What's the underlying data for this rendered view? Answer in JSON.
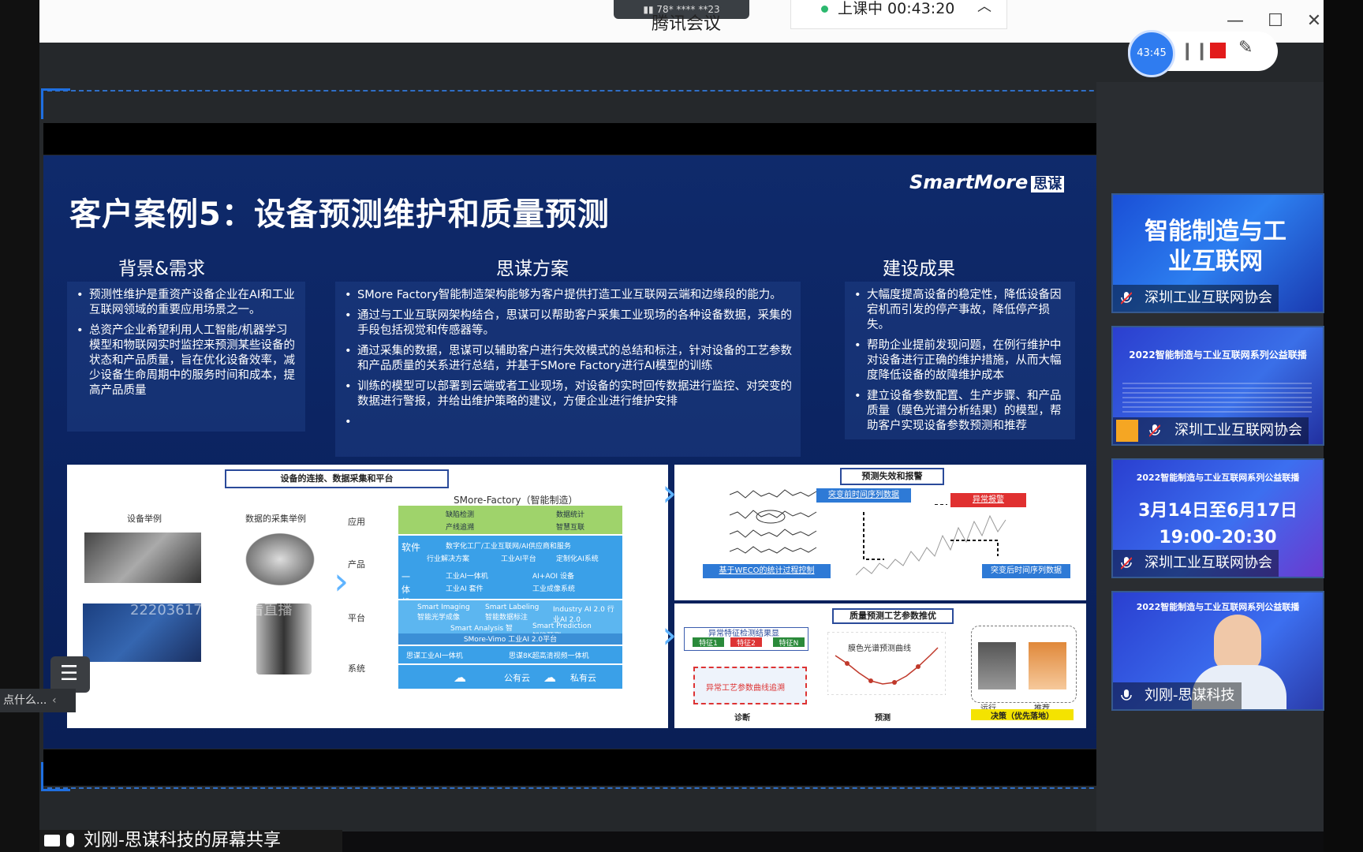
{
  "app": {
    "title": "腾讯会议",
    "signal_text": "78* **** **23",
    "timer_label": "上课中 00:43:20",
    "recording_time": "43:45"
  },
  "slide": {
    "title": "客户案例5：设备预测维护和质量预测",
    "logo": "SmartMore",
    "logo_cn": "思谋",
    "col1": {
      "heading": "背景&需求",
      "bullets": [
        "预测性维护是重资产设备企业在AI和工业互联网领域的重要应用场景之一。",
        "总资产企业希望利用人工智能/机器学习模型和物联网实时监控来预测某些设备的状态和产品质量，旨在优化设备效率，减少设备生命周期中的服务时间和成本，提高产品质量"
      ]
    },
    "col2": {
      "heading": "思谋方案",
      "bullets": [
        "SMore Factory智能制造架构能够为客户提供打造工业互联网云端和边缘段的能力。",
        "通过与工业互联网架构结合，思谋可以帮助客户采集工业现场的各种设备数据，采集的手段包括视觉和传感器等。",
        "通过采集的数据，思谋可以辅助客户进行失效模式的总结和标注，针对设备的工艺参数和产品质量的关系进行总结，并基于SMore Factory进行AI模型的训练",
        "训练的模型可以部署到云端或者工业现场，对设备的实时回传数据进行监控、对突变的数据进行警报，并给出维护策略的建议，方便企业进行维护安排",
        ""
      ]
    },
    "col3": {
      "heading": "建设成果",
      "bullets": [
        "大幅度提高设备的稳定性，降低设备因宕机而引发的停产事故，降低停产损失。",
        "帮助企业提前发现问题，在例行维护中对设备进行正确的维护措施，从而大幅度降低设备的故障维护成本",
        "建立设备参数配置、生产步骤、和产品质量（膜色光谱分析结果）的模型，帮助客户实现设备参数预测和推荐"
      ]
    },
    "diagram1": {
      "title": "设备的连接、数据采集和平台",
      "device_label": "设备举例",
      "data_label": "数据的采集举例",
      "factory_label": "SMore-Factory（智能制造）",
      "rows": [
        "应用",
        "产品",
        "平台",
        "系统"
      ],
      "app_items": [
        "缺陷检测",
        "数据统计",
        "产线追溯",
        "智慧互联"
      ],
      "software_label": "软件",
      "software_items": [
        "数字化工厂/工业互联网/AI供应商和服务",
        "行业解决方案",
        "工业AI平台",
        "定制化AI系统"
      ],
      "integrated_label": "一体机",
      "integrated_items": [
        "工业AI一体机",
        "AI+AOI 设备",
        "工业AI 套件",
        "工业成像系统"
      ],
      "platform_items": [
        "Smart Imaging 智能光学成像",
        "Smart Labeling 智能数据标注",
        "Industry AI 2.0 行业AI 2.0",
        "Smart Analysis 智能分析",
        "Smart Prediction 智能预测"
      ],
      "platform_footer": "SMore-Vimo 工业AI 2.0平台",
      "system_items": [
        "思谋工业AI一体机",
        "思谋8K超高清视频一体机"
      ],
      "cloud_public": "公有云",
      "cloud_private": "私有云",
      "watermark": "22203617 正在观看直播"
    },
    "diagram2": {
      "title": "预测失效和报警",
      "tag1": "突变前时间序列数据",
      "tag2": "异常报警",
      "tag3": "基于WECO的统计过程控制",
      "tag4": "突变后时间序列数据"
    },
    "diagram3": {
      "title": "质量预测工艺参数推优",
      "box_title": "异常特征检测结果显",
      "features": [
        "特征1",
        "特征2",
        "特征N"
      ],
      "trace": "异常工艺参数曲线追溯",
      "curve": "膜色光谱预测曲线",
      "run": "运行",
      "recommend": "推荐",
      "labels": [
        "诊断",
        "预测",
        "决策（优先落地）"
      ]
    }
  },
  "sidebar": {
    "thumbs": [
      {
        "title": "智能制造与工业互联网",
        "name": "深圳工业互联网协会"
      },
      {
        "title": "2022智能制造与工业互联网系列公益联播",
        "name": "深圳工业互联网协会"
      },
      {
        "title": "3月14日至6月17日",
        "subtitle": "19:00-20:30",
        "header": "2022智能制造与工业互联网系列公益联播",
        "name": "深圳工业互联网协会"
      },
      {
        "title": "2022智能制造与工业互联网系列公益联播",
        "name": "刘刚-思谋科技"
      }
    ]
  },
  "bottom": {
    "share_label": "刘刚-思谋科技的屏幕共享",
    "tooltip": "点什么..."
  }
}
